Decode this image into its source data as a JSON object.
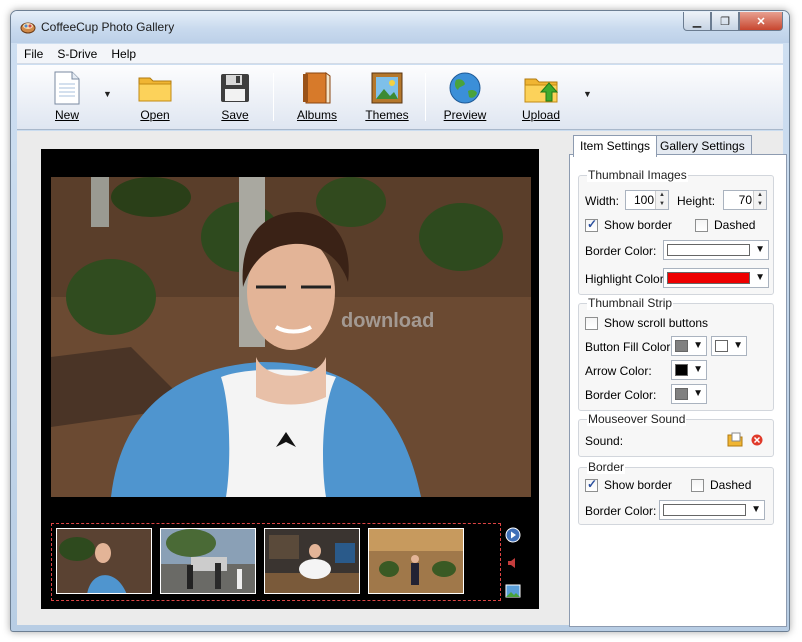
{
  "window": {
    "title": "CoffeeCup Photo Gallery"
  },
  "menu": [
    "File",
    "S-Drive",
    "Help"
  ],
  "toolbar": {
    "new": "New",
    "open": "Open",
    "save": "Save",
    "albums": "Albums",
    "themes": "Themes",
    "preview": "Preview",
    "upload": "Upload"
  },
  "watermark": "download",
  "tabs": {
    "item": "Item Settings",
    "gallery": "Gallery Settings"
  },
  "thumbnail_images": {
    "title": "Thumbnail Images",
    "width_label": "Width:",
    "width_value": "100",
    "height_label": "Height:",
    "height_value": "70",
    "show_border": "Show border",
    "dashed": "Dashed",
    "border_color_label": "Border Color:",
    "border_color": "#ffffff",
    "highlight_color_label": "Highlight Color:",
    "highlight_color": "#ee0000"
  },
  "thumbnail_strip": {
    "title": "Thumbnail Strip",
    "show_scroll": "Show scroll buttons",
    "button_fill_label": "Button Fill Color:",
    "button_fill_color": "#808080",
    "button_fill_color2": "#ffffff",
    "arrow_color_label": "Arrow Color:",
    "arrow_color": "#000000",
    "border_color_label": "Border Color:",
    "border_color": "#808080"
  },
  "mouseover_sound": {
    "title": "Mouseover Sound",
    "sound_label": "Sound:"
  },
  "border": {
    "title": "Border",
    "show_border": "Show border",
    "dashed": "Dashed",
    "border_color_label": "Border Color:",
    "border_color": "#ffffff"
  }
}
